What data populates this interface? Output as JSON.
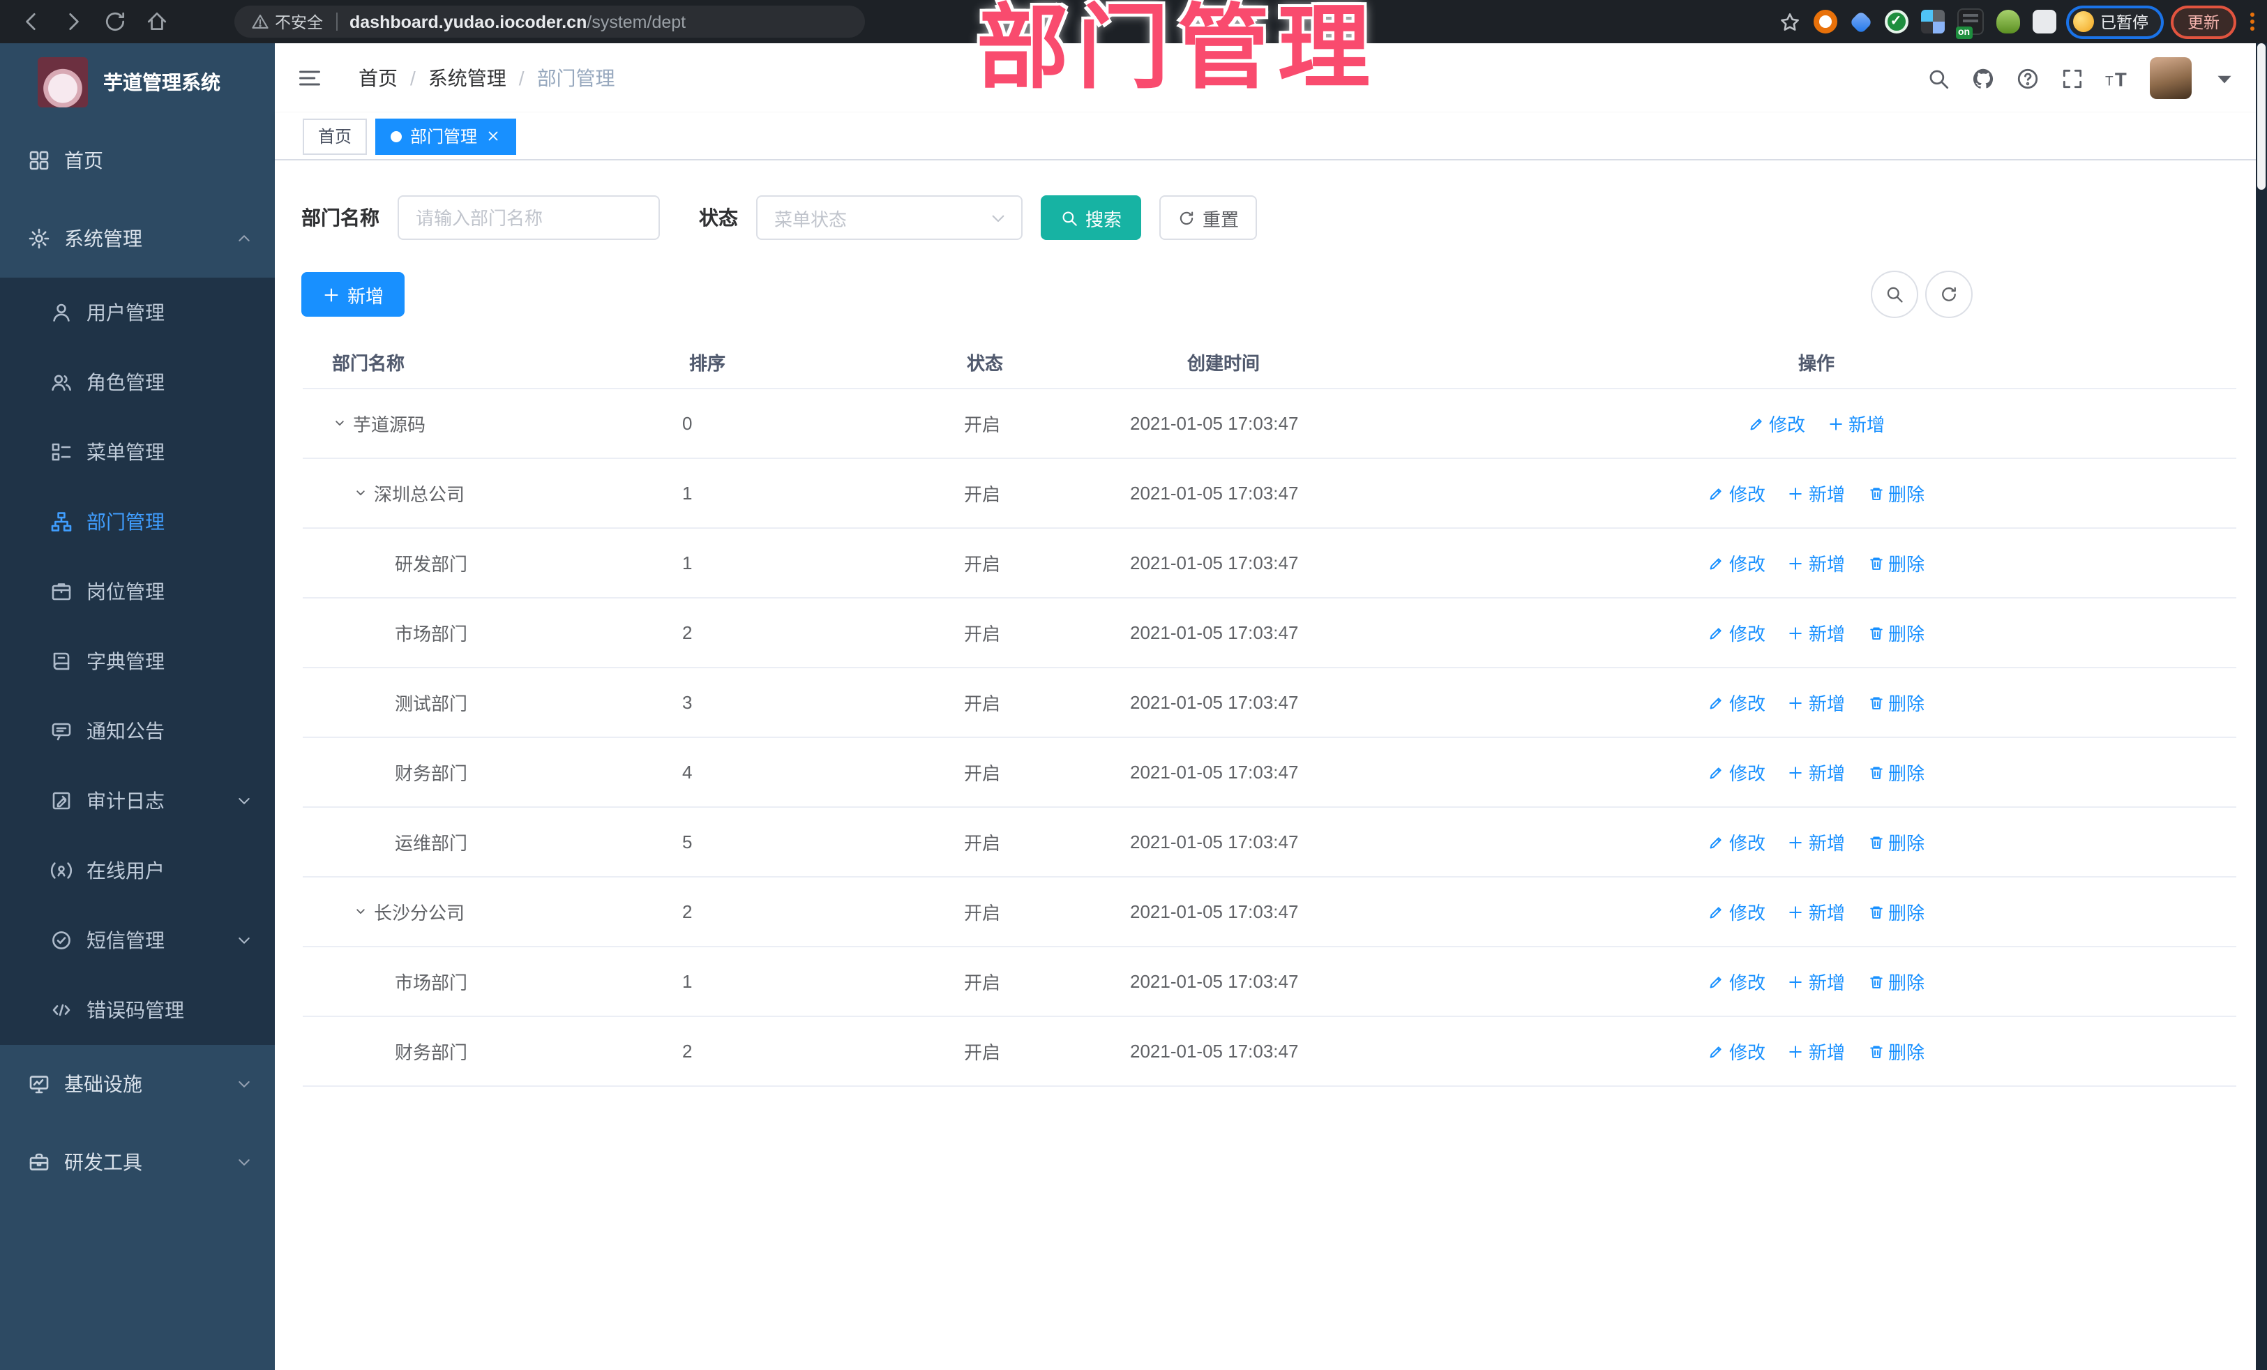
{
  "browser": {
    "nav_icons": [
      "back-icon",
      "forward-icon",
      "reload-icon",
      "home-icon"
    ],
    "url_bar": {
      "warning_label": "不安全",
      "domain": "dashboard.yudao.iocoder.cn",
      "path": "/system/dept"
    },
    "extensions": [
      {
        "icon": "target-extension-icon"
      },
      {
        "icon": "drop-extension-icon"
      },
      {
        "icon": "green-check-extension-icon",
        "glyph": "✓"
      },
      {
        "icon": "grid-extension-icon"
      },
      {
        "icon": "list-extension-icon",
        "badge": "on"
      },
      {
        "icon": "green-person-extension-icon"
      },
      {
        "icon": "puzzle-extension-icon"
      }
    ],
    "profile_chip_label": "已暂停",
    "update_button_label": "更新"
  },
  "annotation": {
    "title": "部门管理",
    "color": "#f94b6e"
  },
  "sidebar": {
    "app_title": "芋道管理系统",
    "items": [
      {
        "label": "首页",
        "icon": "dashboard-icon"
      },
      {
        "label": "系统管理",
        "icon": "gear-icon",
        "expanded": true,
        "children": [
          {
            "label": "用户管理",
            "icon": "user-icon"
          },
          {
            "label": "角色管理",
            "icon": "users-icon"
          },
          {
            "label": "菜单管理",
            "icon": "menu-list-icon"
          },
          {
            "label": "部门管理",
            "icon": "org-tree-icon",
            "active": true
          },
          {
            "label": "岗位管理",
            "icon": "badge-icon"
          },
          {
            "label": "字典管理",
            "icon": "dictionary-icon"
          },
          {
            "label": "通知公告",
            "icon": "announcement-icon"
          },
          {
            "label": "审计日志",
            "icon": "audit-log-icon",
            "chevron": "down"
          },
          {
            "label": "在线用户",
            "icon": "online-user-icon"
          },
          {
            "label": "短信管理",
            "icon": "sms-icon",
            "chevron": "down"
          },
          {
            "label": "错误码管理",
            "icon": "error-code-icon"
          }
        ]
      },
      {
        "label": "基础设施",
        "icon": "infrastructure-icon",
        "chevron": "down"
      },
      {
        "label": "研发工具",
        "icon": "dev-tools-icon",
        "chevron": "down"
      }
    ]
  },
  "header": {
    "breadcrumb": [
      "首页",
      "系统管理",
      "部门管理"
    ],
    "right_icons": [
      "search-icon",
      "github-icon",
      "help-icon",
      "fullscreen-icon",
      "font-size-icon"
    ]
  },
  "tabs": [
    {
      "label": "首页",
      "active": false,
      "closable": false
    },
    {
      "label": "部门管理",
      "active": true,
      "closable": true
    }
  ],
  "filter": {
    "name_label": "部门名称",
    "name_placeholder": "请输入部门名称",
    "name_value": "",
    "status_label": "状态",
    "status_placeholder": "菜单状态",
    "search_label": "搜索",
    "reset_label": "重置"
  },
  "toolbar": {
    "add_label": "新增"
  },
  "table": {
    "headers": [
      "部门名称",
      "排序",
      "状态",
      "创建时间",
      "操作"
    ],
    "action_labels": {
      "edit": "修改",
      "add": "新增",
      "delete": "删除"
    },
    "rows": [
      {
        "name": "芋道源码",
        "level": 0,
        "expandable": true,
        "sort": "0",
        "status": "开启",
        "created": "2021-01-05 17:03:47",
        "actions": [
          "edit",
          "add"
        ]
      },
      {
        "name": "深圳总公司",
        "level": 1,
        "expandable": true,
        "sort": "1",
        "status": "开启",
        "created": "2021-01-05 17:03:47",
        "actions": [
          "edit",
          "add",
          "delete"
        ]
      },
      {
        "name": "研发部门",
        "level": 2,
        "expandable": false,
        "sort": "1",
        "status": "开启",
        "created": "2021-01-05 17:03:47",
        "actions": [
          "edit",
          "add",
          "delete"
        ]
      },
      {
        "name": "市场部门",
        "level": 2,
        "expandable": false,
        "sort": "2",
        "status": "开启",
        "created": "2021-01-05 17:03:47",
        "actions": [
          "edit",
          "add",
          "delete"
        ]
      },
      {
        "name": "测试部门",
        "level": 2,
        "expandable": false,
        "sort": "3",
        "status": "开启",
        "created": "2021-01-05 17:03:47",
        "actions": [
          "edit",
          "add",
          "delete"
        ]
      },
      {
        "name": "财务部门",
        "level": 2,
        "expandable": false,
        "sort": "4",
        "status": "开启",
        "created": "2021-01-05 17:03:47",
        "actions": [
          "edit",
          "add",
          "delete"
        ]
      },
      {
        "name": "运维部门",
        "level": 2,
        "expandable": false,
        "sort": "5",
        "status": "开启",
        "created": "2021-01-05 17:03:47",
        "actions": [
          "edit",
          "add",
          "delete"
        ]
      },
      {
        "name": "长沙分公司",
        "level": 1,
        "expandable": true,
        "sort": "2",
        "status": "开启",
        "created": "2021-01-05 17:03:47",
        "actions": [
          "edit",
          "add",
          "delete"
        ]
      },
      {
        "name": "市场部门",
        "level": 2,
        "expandable": false,
        "sort": "1",
        "status": "开启",
        "created": "2021-01-05 17:03:47",
        "actions": [
          "edit",
          "add",
          "delete"
        ]
      },
      {
        "name": "财务部门",
        "level": 2,
        "expandable": false,
        "sort": "2",
        "status": "开启",
        "created": "2021-01-05 17:03:47",
        "actions": [
          "edit",
          "add",
          "delete"
        ]
      }
    ]
  },
  "colors": {
    "primary": "#1890ff",
    "teal": "#17b3a3",
    "annotation_pink": "#f94b6e",
    "active_menu": "#409eff"
  }
}
